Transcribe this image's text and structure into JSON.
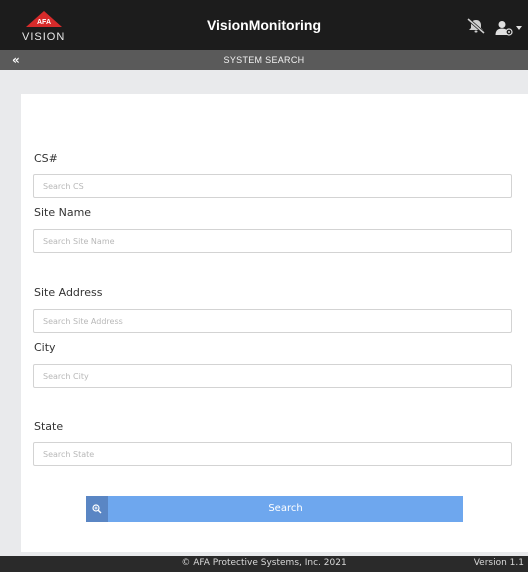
{
  "header": {
    "logo_text": "VISION",
    "title": "VisionMonitoring",
    "icons": [
      "notifications-off-icon",
      "user-menu-icon",
      "caret-down-icon"
    ]
  },
  "subbar": {
    "back_icon": "double-chevron-left-icon",
    "back_glyph": "«",
    "title": "SYSTEM SEARCH"
  },
  "form": {
    "cs": {
      "label": "CS#",
      "placeholder": "Search CS",
      "value": ""
    },
    "site_name": {
      "label": "Site Name",
      "placeholder": "Search Site Name",
      "value": ""
    },
    "site_address": {
      "label": "Site Address",
      "placeholder": "Search Site Address",
      "value": ""
    },
    "city": {
      "label": "City",
      "placeholder": "Search City",
      "value": ""
    },
    "state": {
      "label": "State",
      "placeholder": "Search State",
      "value": ""
    },
    "search_button": {
      "label": "Search",
      "icon": "zoom-in-icon"
    }
  },
  "footer": {
    "copyright": "© AFA Protective Systems, Inc. 2021",
    "version": "Version 1.1"
  },
  "colors": {
    "header_bg": "#1c1c1c",
    "subbar_bg": "#5a5a5a",
    "page_bg": "#e9eaec",
    "button_bg": "#6ea7ee",
    "button_icon_bg": "#5a86c4",
    "logo_red": "#d62b2b"
  }
}
